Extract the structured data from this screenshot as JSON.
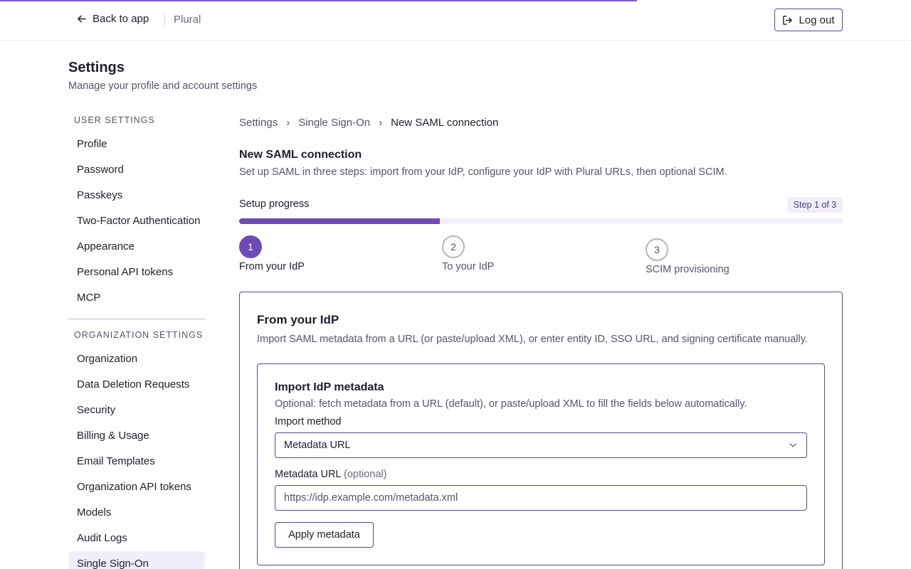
{
  "header": {
    "back_label": "Back to app",
    "brand": "Plural",
    "logout_label": "Log out"
  },
  "page": {
    "title": "Settings",
    "subtitle": "Manage your profile and account settings"
  },
  "sidebar": {
    "user_heading": "USER SETTINGS",
    "user_items": [
      {
        "label": "Profile"
      },
      {
        "label": "Password"
      },
      {
        "label": "Passkeys"
      },
      {
        "label": "Two-Factor Authentication"
      },
      {
        "label": "Appearance"
      },
      {
        "label": "Personal API tokens"
      },
      {
        "label": "MCP"
      }
    ],
    "org_heading": "ORGANIZATION SETTINGS",
    "org_items": [
      {
        "label": "Organization"
      },
      {
        "label": "Data Deletion Requests"
      },
      {
        "label": "Security"
      },
      {
        "label": "Billing & Usage"
      },
      {
        "label": "Email Templates"
      },
      {
        "label": "Organization API tokens"
      },
      {
        "label": "Models"
      },
      {
        "label": "Audit Logs"
      },
      {
        "label": "Single Sign-On"
      }
    ]
  },
  "breadcrumb": [
    "Settings",
    "Single Sign-On",
    "New SAML connection"
  ],
  "section": {
    "title": "New SAML connection",
    "description": "Set up SAML in three steps: import from your IdP, configure your IdP with Plural URLs, then optional SCIM."
  },
  "progress": {
    "label": "Setup progress",
    "badge": "Step 1 of 3",
    "fraction": 0.333,
    "steps": [
      {
        "number": "1",
        "label": "From your IdP",
        "active": true
      },
      {
        "number": "2",
        "label": "To your IdP",
        "active": false
      },
      {
        "number": "3",
        "label": "SCIM provisioning",
        "active": false
      }
    ]
  },
  "card": {
    "title": "From your IdP",
    "description": "Import SAML metadata from a URL (or paste/upload XML), or enter entity ID, SSO URL, and signing certificate manually."
  },
  "import": {
    "title": "Import IdP metadata",
    "description": "Optional: fetch metadata from a URL (default), or paste/upload XML to fill the fields below automatically.",
    "method_label": "Import method",
    "method_value": "Metadata URL",
    "url_label": "Metadata URL",
    "url_optional": "(optional)",
    "url_placeholder": "https://idp.example.com/metadata.xml",
    "apply_label": "Apply metadata"
  },
  "colors": {
    "accent": "#6d4ab5",
    "accent_light": "#f1eef9",
    "border": "#5a4a8a"
  },
  "icons": {
    "back": "arrow-left-icon",
    "logout": "log-out-icon",
    "breadcrumb_sep": "chevron-right-icon",
    "select": "chevron-down-icon"
  }
}
